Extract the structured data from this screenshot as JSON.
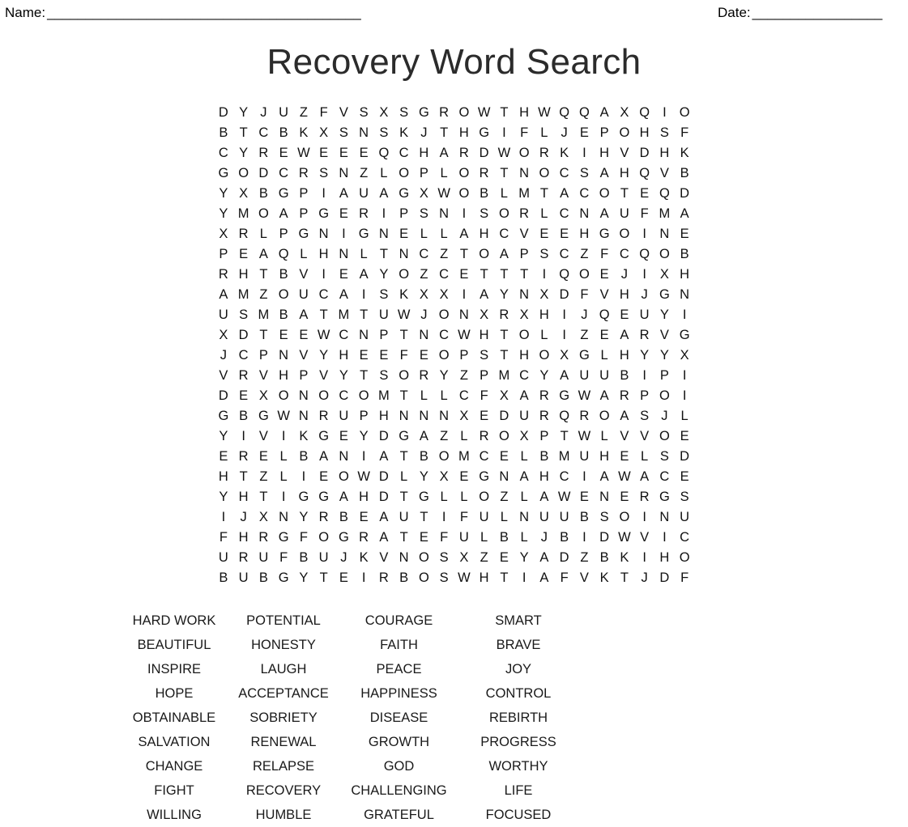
{
  "header": {
    "name_label": "Name:",
    "name_rule": "_________________________________________",
    "date_label": "Date:",
    "date_rule": "_________________"
  },
  "title": "Recovery Word Search",
  "grid": {
    "rows": 24,
    "cols": 24,
    "letters": [
      [
        "D",
        "Y",
        "J",
        "U",
        "Z",
        "F",
        "V",
        "S",
        "X",
        "S",
        "G",
        "R",
        "O",
        "W",
        "T",
        "H",
        "W",
        "Q",
        "Q",
        "A",
        "X",
        "Q",
        "I",
        "O"
      ],
      [
        "B",
        "T",
        "C",
        "B",
        "K",
        "X",
        "S",
        "N",
        "S",
        "K",
        "J",
        "T",
        "H",
        "G",
        "I",
        "F",
        "L",
        "J",
        "E",
        "P",
        "O",
        "H",
        "S",
        "F"
      ],
      [
        "C",
        "Y",
        "R",
        "E",
        "W",
        "E",
        "E",
        "E",
        "Q",
        "C",
        "H",
        "A",
        "R",
        "D",
        "W",
        "O",
        "R",
        "K",
        "I",
        "H",
        "V",
        "D",
        "H",
        "K"
      ],
      [
        "G",
        "O",
        "D",
        "C",
        "R",
        "S",
        "N",
        "Z",
        "L",
        "O",
        "P",
        "L",
        "O",
        "R",
        "T",
        "N",
        "O",
        "C",
        "S",
        "A",
        "H",
        "Q",
        "V",
        "B"
      ],
      [
        "Y",
        "X",
        "B",
        "G",
        "P",
        "I",
        "A",
        "U",
        "A",
        "G",
        "X",
        "W",
        "O",
        "B",
        "L",
        "M",
        "T",
        "A",
        "C",
        "O",
        "T",
        "E",
        "Q",
        "D"
      ],
      [
        "Y",
        "M",
        "O",
        "A",
        "P",
        "G",
        "E",
        "R",
        "I",
        "P",
        "S",
        "N",
        "I",
        "S",
        "O",
        "R",
        "L",
        "C",
        "N",
        "A",
        "U",
        "F",
        "M",
        "A"
      ],
      [
        "X",
        "R",
        "L",
        "P",
        "G",
        "N",
        "I",
        "G",
        "N",
        "E",
        "L",
        "L",
        "A",
        "H",
        "C",
        "V",
        "E",
        "E",
        "H",
        "G",
        "O",
        "I",
        "N",
        "E"
      ],
      [
        "P",
        "E",
        "A",
        "Q",
        "L",
        "H",
        "N",
        "L",
        "T",
        "N",
        "C",
        "Z",
        "T",
        "O",
        "A",
        "P",
        "S",
        "C",
        "Z",
        "F",
        "C",
        "Q",
        "O",
        "B"
      ],
      [
        "R",
        "H",
        "T",
        "B",
        "V",
        "I",
        "E",
        "A",
        "Y",
        "O",
        "Z",
        "C",
        "E",
        "T",
        "T",
        "T",
        "I",
        "Q",
        "O",
        "E",
        "J",
        "I",
        "X",
        "H"
      ],
      [
        "A",
        "M",
        "Z",
        "O",
        "U",
        "C",
        "A",
        "I",
        "S",
        "K",
        "X",
        "X",
        "I",
        "A",
        "Y",
        "N",
        "X",
        "D",
        "F",
        "V",
        "H",
        "J",
        "G",
        "N"
      ],
      [
        "U",
        "S",
        "M",
        "B",
        "A",
        "T",
        "M",
        "T",
        "U",
        "W",
        "J",
        "O",
        "N",
        "X",
        "R",
        "X",
        "H",
        "I",
        "J",
        "Q",
        "E",
        "U",
        "Y",
        "I"
      ],
      [
        "X",
        "D",
        "T",
        "E",
        "E",
        "W",
        "C",
        "N",
        "P",
        "T",
        "N",
        "C",
        "W",
        "H",
        "T",
        "O",
        "L",
        "I",
        "Z",
        "E",
        "A",
        "R",
        "V",
        "G"
      ],
      [
        "J",
        "C",
        "P",
        "N",
        "V",
        "Y",
        "H",
        "E",
        "E",
        "F",
        "E",
        "O",
        "P",
        "S",
        "T",
        "H",
        "O",
        "X",
        "G",
        "L",
        "H",
        "Y",
        "Y",
        "X"
      ],
      [
        "V",
        "R",
        "V",
        "H",
        "P",
        "V",
        "Y",
        "T",
        "S",
        "O",
        "R",
        "Y",
        "Z",
        "P",
        "M",
        "C",
        "Y",
        "A",
        "U",
        "U",
        "B",
        "I",
        "P",
        "I"
      ],
      [
        "D",
        "E",
        "X",
        "O",
        "N",
        "O",
        "C",
        "O",
        "M",
        "T",
        "L",
        "L",
        "C",
        "F",
        "X",
        "A",
        "R",
        "G",
        "W",
        "A",
        "R",
        "P",
        "O",
        "I"
      ],
      [
        "G",
        "B",
        "G",
        "W",
        "N",
        "R",
        "U",
        "P",
        "H",
        "N",
        "N",
        "N",
        "X",
        "E",
        "D",
        "U",
        "R",
        "Q",
        "R",
        "O",
        "A",
        "S",
        "J",
        "L"
      ],
      [
        "Y",
        "I",
        "V",
        "I",
        "K",
        "G",
        "E",
        "Y",
        "D",
        "G",
        "A",
        "Z",
        "L",
        "R",
        "O",
        "X",
        "P",
        "T",
        "W",
        "L",
        "V",
        "V",
        "O",
        "E"
      ],
      [
        "E",
        "R",
        "E",
        "L",
        "B",
        "A",
        "N",
        "I",
        "A",
        "T",
        "B",
        "O",
        "M",
        "C",
        "E",
        "L",
        "B",
        "M",
        "U",
        "H",
        "E",
        "L",
        "S",
        "D"
      ],
      [
        "H",
        "T",
        "Z",
        "L",
        "I",
        "E",
        "O",
        "W",
        "D",
        "L",
        "Y",
        "X",
        "E",
        "G",
        "N",
        "A",
        "H",
        "C",
        "I",
        "A",
        "W",
        "A",
        "C",
        "E"
      ],
      [
        "Y",
        "H",
        "T",
        "I",
        "G",
        "G",
        "A",
        "H",
        "D",
        "T",
        "G",
        "L",
        "L",
        "O",
        "Z",
        "L",
        "A",
        "W",
        "E",
        "N",
        "E",
        "R",
        "G",
        "S"
      ],
      [
        "I",
        "J",
        "X",
        "N",
        "Y",
        "R",
        "B",
        "E",
        "A",
        "U",
        "T",
        "I",
        "F",
        "U",
        "L",
        "N",
        "U",
        "U",
        "B",
        "S",
        "O",
        "I",
        "N",
        "U"
      ],
      [
        "F",
        "H",
        "R",
        "G",
        "F",
        "O",
        "G",
        "R",
        "A",
        "T",
        "E",
        "F",
        "U",
        "L",
        "B",
        "L",
        "J",
        "B",
        "I",
        "D",
        "W",
        "V",
        "I",
        "C"
      ],
      [
        "U",
        "R",
        "U",
        "F",
        "B",
        "U",
        "J",
        "K",
        "V",
        "N",
        "O",
        "S",
        "X",
        "Z",
        "E",
        "Y",
        "A",
        "D",
        "Z",
        "B",
        "K",
        "I",
        "H",
        "O"
      ],
      [
        "B",
        "U",
        "B",
        "G",
        "Y",
        "T",
        "E",
        "I",
        "R",
        "B",
        "O",
        "S",
        "W",
        "H",
        "T",
        "I",
        "A",
        "F",
        "V",
        "K",
        "T",
        "J",
        "D",
        "F"
      ]
    ]
  },
  "wordlist": {
    "rows": [
      [
        "HARD WORK",
        "POTENTIAL",
        "COURAGE",
        "SMART"
      ],
      [
        "BEAUTIFUL",
        "HONESTY",
        "FAITH",
        "BRAVE"
      ],
      [
        "INSPIRE",
        "LAUGH",
        "PEACE",
        "JOY"
      ],
      [
        "HOPE",
        "ACCEPTANCE",
        "HAPPINESS",
        "CONTROL"
      ],
      [
        "OBTAINABLE",
        "SOBRIETY",
        "DISEASE",
        "REBIRTH"
      ],
      [
        "SALVATION",
        "RENEWAL",
        "GROWTH",
        "PROGRESS"
      ],
      [
        "CHANGE",
        "RELAPSE",
        "GOD",
        "WORTHY"
      ],
      [
        "FIGHT",
        "RECOVERY",
        "CHALLENGING",
        "LIFE"
      ],
      [
        "WILLING",
        "HUMBLE",
        "GRATEFUL",
        "FOCUSED"
      ]
    ]
  }
}
